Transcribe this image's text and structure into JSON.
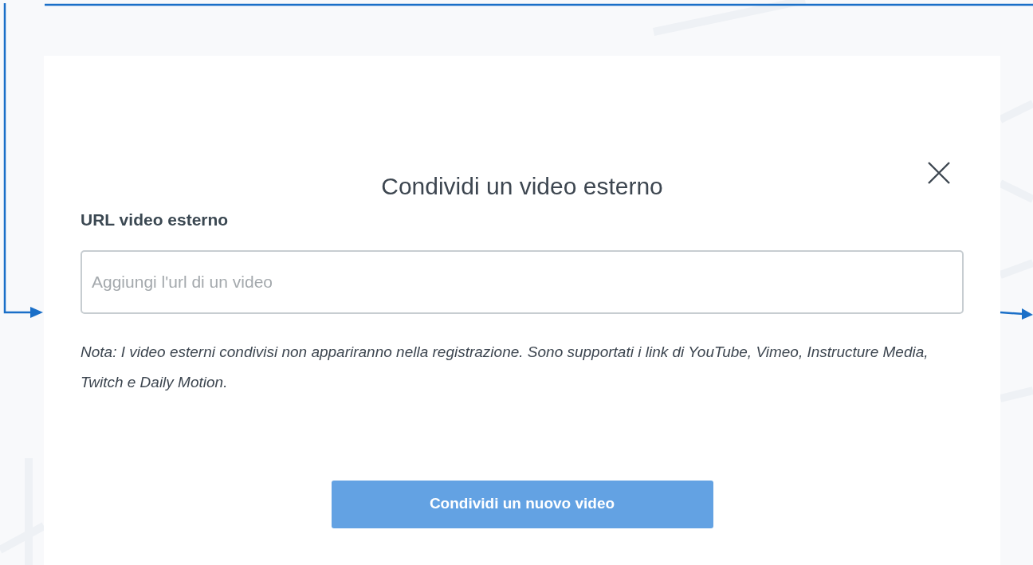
{
  "dialog": {
    "title": "Condividi un video esterno",
    "field": {
      "label": "URL video esterno",
      "placeholder": "Aggiungi l'url di un video"
    },
    "note": "Nota: I video esterni condivisi non appariranno nella registrazione. Sono supportati i link di YouTube, Vimeo, Instructure Media, Twitch e Daily Motion.",
    "submit": {
      "label": "Condividi un nuovo video",
      "disabled": true
    }
  }
}
